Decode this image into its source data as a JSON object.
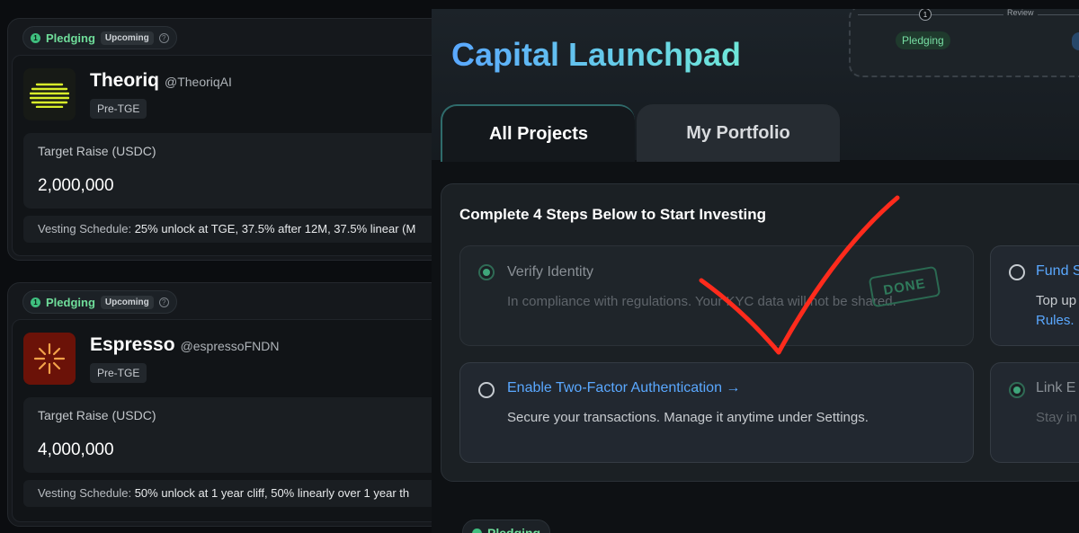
{
  "projects": [
    {
      "step_num": "1",
      "status": "Pledging",
      "badge": "Upcoming",
      "help": "?",
      "name": "Theoriq",
      "handle": "@TheoriqAI",
      "tag": "Pre-TGE",
      "raise_label": "Target Raise (USDC)",
      "raise_value": "2,000,000",
      "vesting_label": "Vesting Schedule: ",
      "vesting_value": "25% unlock at TGE, 37.5% after 12M, 37.5% linear (M"
    },
    {
      "step_num": "1",
      "status": "Pledging",
      "badge": "Upcoming",
      "help": "?",
      "name": "Espresso",
      "handle": "@espressoFNDN",
      "tag": "Pre-TGE",
      "raise_label": "Target Raise (USDC)",
      "raise_value": "4,000,000",
      "vesting_label": "Vesting Schedule: ",
      "vesting_value": "50% unlock at 1 year cliff, 50% linearly over 1 year th"
    }
  ],
  "header": {
    "title": "Capital Launchpad",
    "timeline": {
      "step_num": "1",
      "review": "Review",
      "pledging": "Pledging"
    }
  },
  "tabs": {
    "all": "All Projects",
    "portfolio": "My Portfolio"
  },
  "steps": {
    "heading": "Complete 4 Steps Below to Start Investing",
    "verify": {
      "title": "Verify Identity",
      "desc": "In compliance with regulations. Your KYC data will not be shared.",
      "stamp": "DONE"
    },
    "twofa": {
      "title": "Enable Two-Factor Authentication",
      "arrow": "→",
      "desc": "Secure your transactions. Manage it anytime under Settings."
    },
    "fund": {
      "title": "Fund S",
      "desc": "Top up",
      "link": "Rules."
    },
    "link": {
      "title": "Link E",
      "desc": "Stay in"
    }
  },
  "bottom_pill": {
    "label": "Pledging"
  },
  "colors": {
    "accent_green": "#6fdd9a",
    "accent_blue": "#5aa8ff",
    "annotation_red": "#ff2b1c"
  },
  "annotation": "red-checkmark"
}
